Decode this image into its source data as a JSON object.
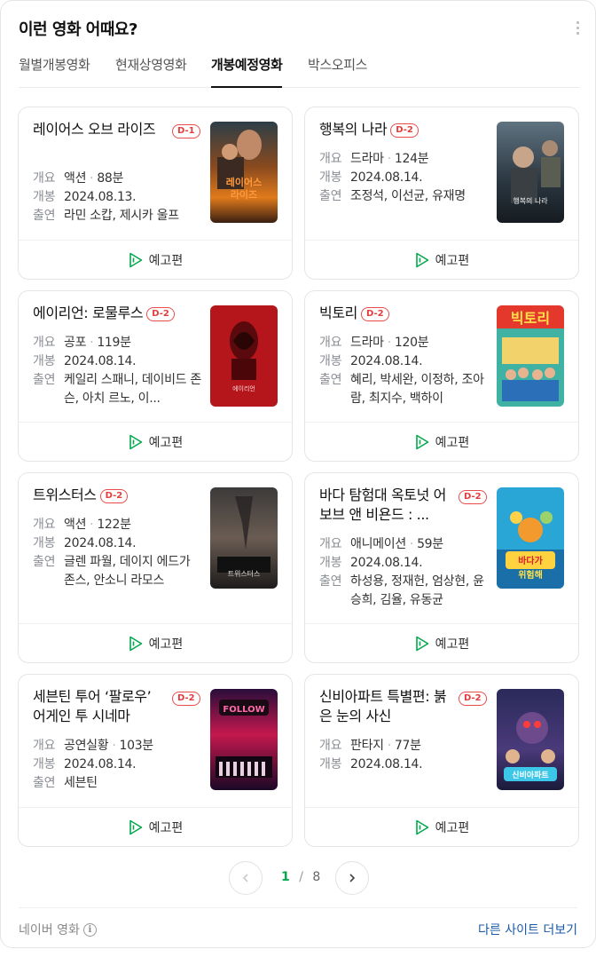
{
  "header": {
    "title": "이런 영화 어때요?"
  },
  "tabs": [
    {
      "label": "월별개봉영화",
      "active": false
    },
    {
      "label": "현재상영영화",
      "active": false
    },
    {
      "label": "개봉예정영화",
      "active": true
    },
    {
      "label": "박스오피스",
      "active": false
    }
  ],
  "labels": {
    "genre": "개요",
    "release": "개봉",
    "cast": "출연",
    "trailer": "예고편",
    "dot": "·"
  },
  "movies": [
    {
      "title": "레이어스 오브 라이즈",
      "badge": "D-1",
      "genre": "액션",
      "runtime": "88분",
      "release": "2024.08.13.",
      "cast": "라민 소캅, 제시카 울프",
      "poster_text": "레이어스 오브 라이즈"
    },
    {
      "title": "행복의 나라",
      "badge": "D-2",
      "genre": "드라마",
      "runtime": "124분",
      "release": "2024.08.14.",
      "cast": "조정석, 이선균, 유재명",
      "poster_text": "행복의 나라"
    },
    {
      "title": "에이리언: 로물루스",
      "badge": "D-2",
      "genre": "공포",
      "runtime": "119분",
      "release": "2024.08.14.",
      "cast": "케일리 스패니, 데이비드 존슨, 아치 르노, 이...",
      "poster_text": "에이리언"
    },
    {
      "title": "빅토리",
      "badge": "D-2",
      "genre": "드라마",
      "runtime": "120분",
      "release": "2024.08.14.",
      "cast": "혜리, 박세완, 이정하, 조아람, 최지수, 백하이",
      "poster_text": "빅토리"
    },
    {
      "title": "트위스터스",
      "badge": "D-2",
      "genre": "액션",
      "runtime": "122분",
      "release": "2024.08.14.",
      "cast": "글렌 파월, 데이지 에드가 존스, 안소니 라모스",
      "poster_text": "트위스터스"
    },
    {
      "title": "바다 탐험대 옥토넛 어보브 앤 비욘드 : ...",
      "badge": "D-2",
      "genre": "애니메이션",
      "runtime": "59분",
      "release": "2024.08.14.",
      "cast": "하성용, 정재헌, 엄상현, 윤승희, 김율, 유동균",
      "poster_text": "바다가 위험해"
    },
    {
      "title": "세븐틴 투어 ‘팔로우’ 어게인 투 시네마",
      "badge": "D-2",
      "genre": "공연실황",
      "runtime": "103분",
      "release": "2024.08.14.",
      "cast": "세븐틴",
      "poster_text": "FOLLOW"
    },
    {
      "title": "신비아파트 특별편: 붉은 눈의 사신",
      "badge": "D-2",
      "genre": "판타지",
      "runtime": "77분",
      "release": "2024.08.14.",
      "cast": "",
      "poster_text": "신비아파트"
    }
  ],
  "pagination": {
    "current": "1",
    "separator": "/",
    "total": "8"
  },
  "footer": {
    "source": "네이버 영화",
    "more_link": "다른 사이트 더보기"
  },
  "colors": {
    "badge": "#e23c3c",
    "accent": "#03a94d",
    "link": "#1a5aa8"
  }
}
